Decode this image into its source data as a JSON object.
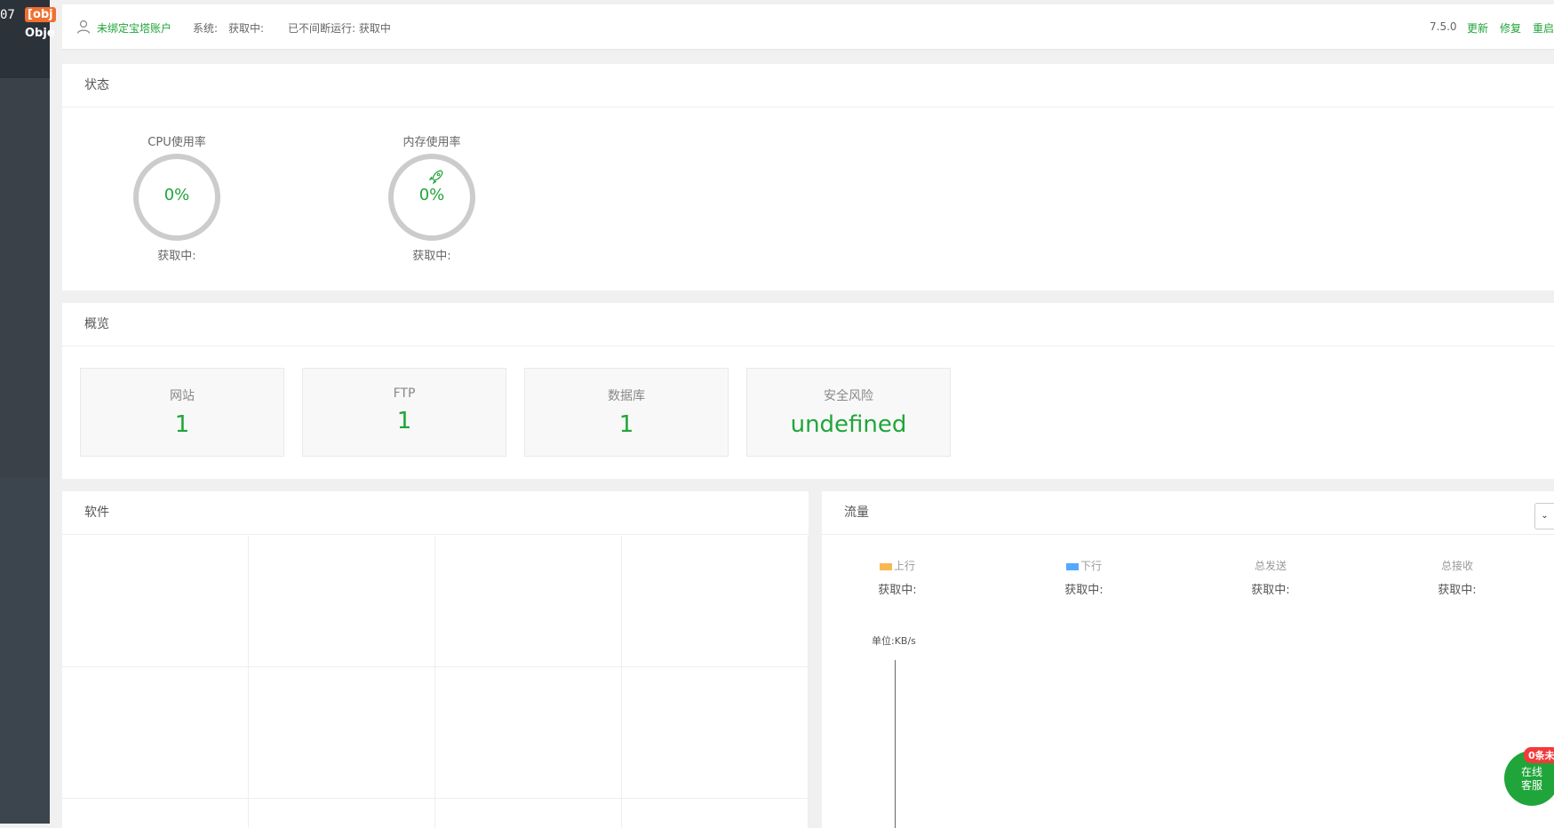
{
  "sidebar": {
    "version_fragment": "07",
    "obj_badge": "[obj",
    "obj_text": "Obje"
  },
  "topbar": {
    "account": "未绑定宝塔账户",
    "system_label": "系统:",
    "system_value": "获取中:",
    "uptime": "已不间断运行: 获取中",
    "version": "7.5.0",
    "update": "更新",
    "repair": "修复",
    "restart": "重启"
  },
  "status": {
    "title": "状态",
    "gauges": [
      {
        "title": "CPU使用率",
        "value": "0%",
        "percent": 0,
        "sub": "获取中:"
      },
      {
        "title": "内存使用率",
        "value": "0%",
        "percent": 0,
        "sub": "获取中:"
      }
    ]
  },
  "overview": {
    "title": "概览",
    "cards": [
      {
        "label": "网站",
        "value": "1"
      },
      {
        "label": "FTP",
        "value": "1"
      },
      {
        "label": "数据库",
        "value": "1"
      },
      {
        "label": "安全风险",
        "value": "undefined"
      }
    ]
  },
  "software": {
    "title": "软件"
  },
  "traffic": {
    "title": "流量",
    "dropdown_icon": "chevron-down-icon",
    "stats": [
      {
        "label": "上行",
        "value": "获取中:",
        "color": "#f7b851"
      },
      {
        "label": "下行",
        "value": "获取中:",
        "color": "#52a9ff"
      },
      {
        "label": "总发送",
        "value": "获取中:"
      },
      {
        "label": "总接收",
        "value": "获取中:"
      }
    ],
    "unit": "单位:KB/s"
  },
  "service": {
    "badge": "0条未",
    "line1": "在线",
    "line2": "客服"
  },
  "colors": {
    "accent": "#20a53a",
    "sidebar": "#3c444d",
    "badge": "#f23a3a"
  }
}
